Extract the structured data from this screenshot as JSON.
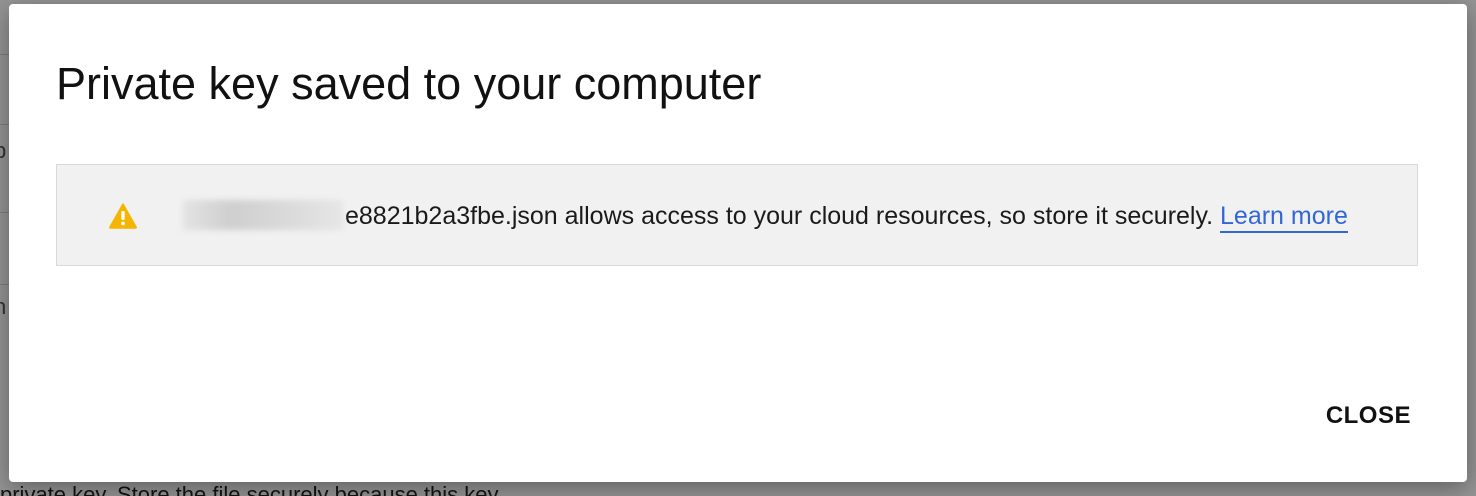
{
  "background": {
    "glyphs": [
      "p",
      "n"
    ],
    "bottom_text": "private key. Store the file securely because this key"
  },
  "dialog": {
    "title": "Private key saved to your computer",
    "notice": {
      "icon": "warning-icon",
      "icon_color": "#f4b400",
      "redacted_prefix": "",
      "filename_suffix": "e8821b2a3fbe.json",
      "message": " allows access to your cloud resources, so store it securely. ",
      "link_label": "Learn more",
      "link_color": "#3367d6"
    },
    "close_label": "CLOSE"
  }
}
